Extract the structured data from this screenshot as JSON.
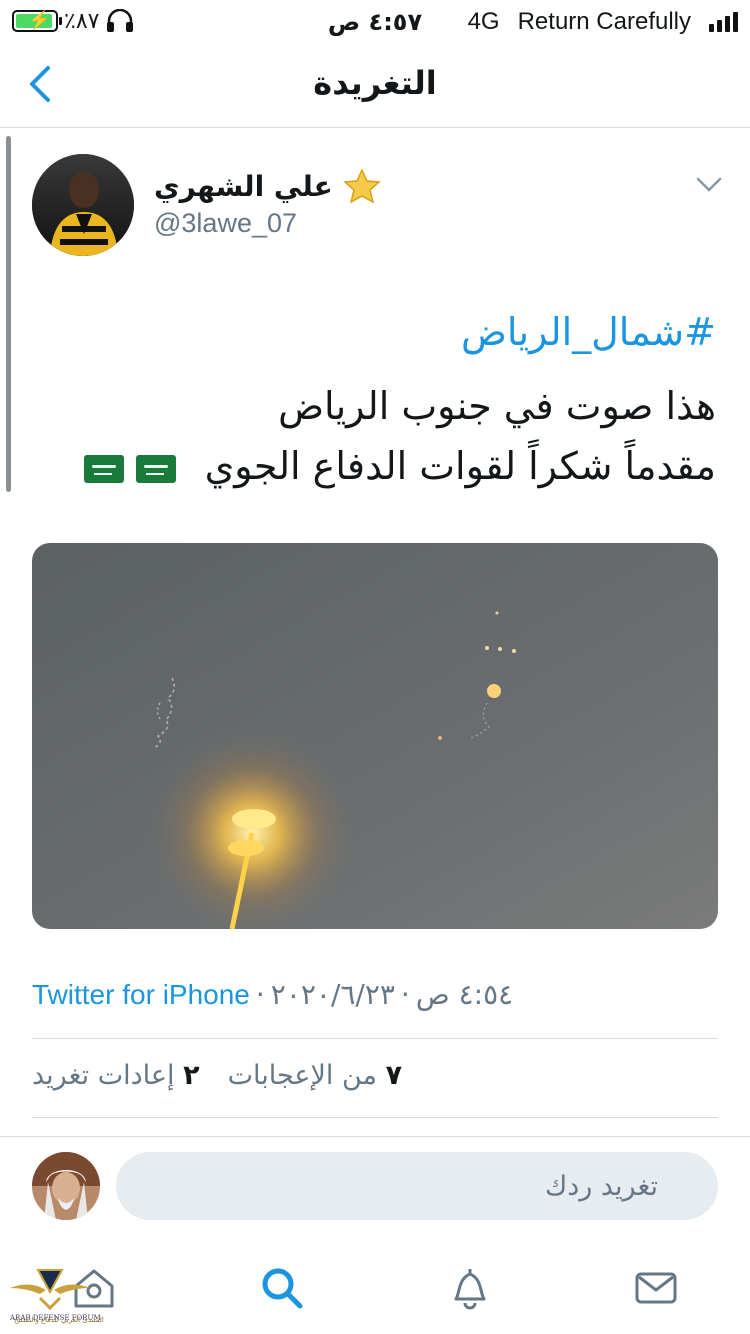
{
  "status_bar": {
    "battery": "٪٨٧",
    "time": "٤:٥٧ ص",
    "network": "4G",
    "carrier": "Return Carefully"
  },
  "nav": {
    "title": "التغريدة"
  },
  "tweet": {
    "author_name": "علي الشهري",
    "author_handle": "@3lawe_07",
    "hashtag": "#شمال_الرياض",
    "line1": "هذا صوت في جنوب الرياض",
    "line2": "مقدماً شكراً لقوات الدفاع الجوي",
    "time": "٤:٥٤ ص",
    "separator": "·",
    "date": "٢٠٢٠/٦/٢٣",
    "source": "Twitter for iPhone",
    "likes_count": "٧",
    "likes_label": "من الإعجابات",
    "retweets_count": "٢",
    "retweets_label": "إعادات تغريد"
  },
  "reply": {
    "placeholder": "تغريد ردك"
  },
  "watermark": {
    "title": "ARAB DEFENSE FORUM",
    "subtitle": "المنتدى العربي للدفاع والتسليح"
  },
  "colors": {
    "accent": "#1b95e0",
    "secondary_text": "#657786",
    "divider": "#d6dbdf"
  },
  "icons": {
    "tabs": [
      "home-icon",
      "search-icon",
      "notifications-icon",
      "messages-icon"
    ]
  }
}
